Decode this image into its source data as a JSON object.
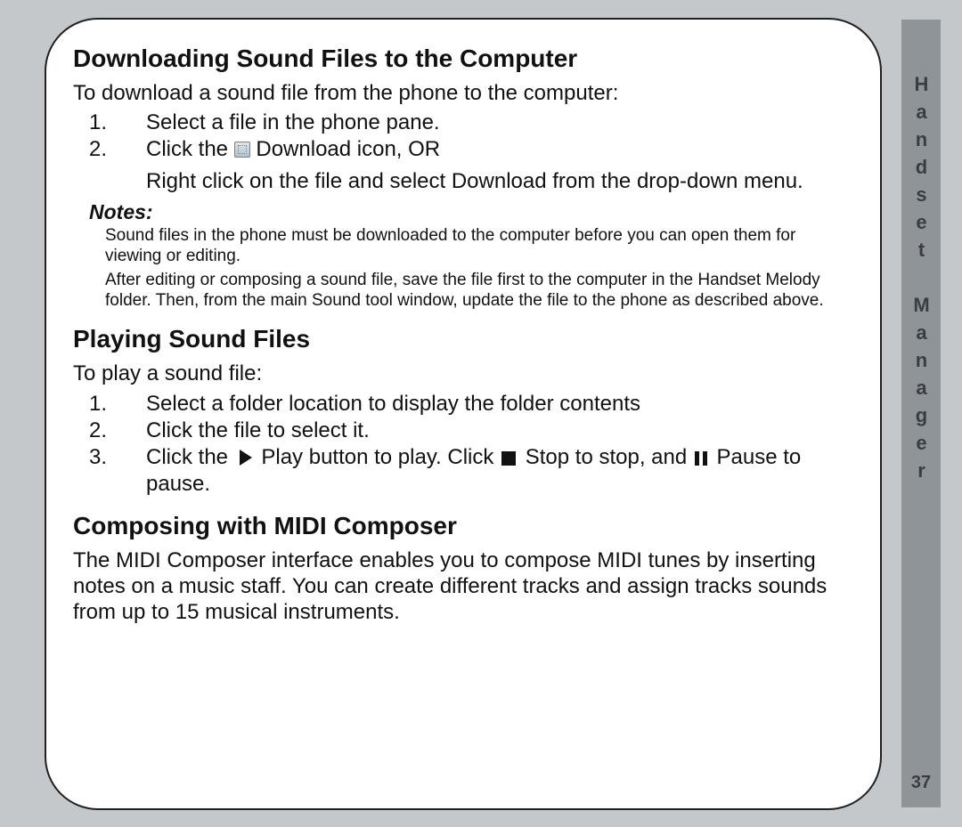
{
  "sidebar": {
    "title": "Handset Manager",
    "page_number": "37"
  },
  "sections": {
    "downloading": {
      "heading": "Downloading Sound Files to the Computer",
      "intro": "To download a sound file from the phone to the computer:",
      "step1": "Select a file in the phone pane.",
      "step2_a": "Click the ",
      "step2_b": " Download icon, OR",
      "step2_cont": "Right click on the file and select Download from the drop-down menu.",
      "notes_label": "Notes:",
      "note1": "Sound files in the phone must be downloaded to the computer before you can open them for viewing or editing.",
      "note2": "After editing or composing a sound file, save the file first to the computer in the Handset Melody folder. Then, from the main Sound tool window, update the file to the phone as described above."
    },
    "playing": {
      "heading": "Playing Sound Files",
      "intro": "To play a sound file:",
      "step1": "Select a folder location to display the folder contents",
      "step2": "Click the file to select it.",
      "step3_a": "Click the ",
      "step3_b": " Play button to play. Click ",
      "step3_c": " Stop to stop, and ",
      "step3_d": " Pause to pause."
    },
    "composing": {
      "heading": "Composing with MIDI Composer",
      "body": "The MIDI Composer interface enables you to compose MIDI tunes by inserting notes on a music staff. You can create different tracks and assign tracks sounds from up to 15 musical instruments."
    }
  }
}
